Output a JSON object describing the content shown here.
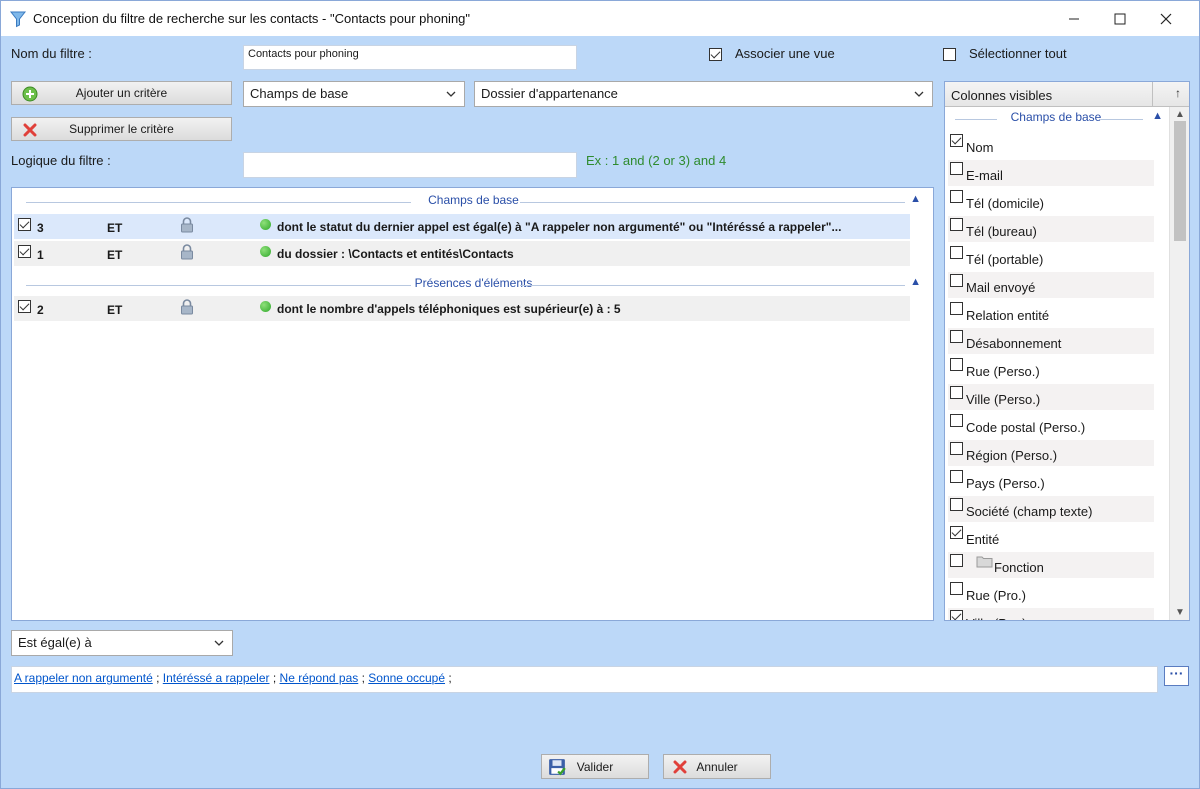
{
  "window": {
    "title": "Conception du filtre de recherche sur les contacts - \"Contacts pour phoning\""
  },
  "form": {
    "filter_name_label": "Nom du filtre :",
    "filter_name_value": "Contacts pour phoning",
    "associate_view_label": "Associer une vue",
    "associate_view_checked": true,
    "select_all_label": "Sélectionner tout",
    "select_all_checked": false,
    "add_criterion_label": "Ajouter un critère",
    "remove_criterion_label": "Supprimer le critère",
    "field_category_select": "Champs de base",
    "field_select": "Dossier d'appartenance",
    "filter_logic_label": "Logique du filtre :",
    "filter_logic_value": "",
    "filter_logic_example": "Ex : 1 and (2 or 3) and 4"
  },
  "criteria": {
    "groups": [
      {
        "name": "Champs de base",
        "rows": [
          {
            "checked": true,
            "num": "3",
            "op": "ET",
            "text": "dont le statut du dernier appel est égal(e) à \"A rappeler non argumenté\" ou \"Intéréssé a rappeler\"...",
            "selected": true
          },
          {
            "checked": true,
            "num": "1",
            "op": "ET",
            "text": "du dossier : \\Contacts et entités\\Contacts",
            "selected": false
          }
        ]
      },
      {
        "name": "Présences d'éléments",
        "rows": [
          {
            "checked": true,
            "num": "2",
            "op": "ET",
            "text": "dont le nombre d'appels téléphoniques est supérieur(e) à : 5",
            "selected": false
          }
        ]
      }
    ]
  },
  "columns": {
    "header": "Colonnes visibles",
    "group": "Champs de base",
    "items": [
      {
        "label": "Nom",
        "checked": true
      },
      {
        "label": "E-mail",
        "checked": false
      },
      {
        "label": "Tél (domicile)",
        "checked": false
      },
      {
        "label": "Tél (bureau)",
        "checked": false
      },
      {
        "label": "Tél (portable)",
        "checked": false
      },
      {
        "label": "Mail envoyé",
        "checked": false
      },
      {
        "label": "Relation entité",
        "checked": false
      },
      {
        "label": "Désabonnement",
        "checked": false
      },
      {
        "label": "Rue (Perso.)",
        "checked": false
      },
      {
        "label": "Ville (Perso.)",
        "checked": false
      },
      {
        "label": "Code postal (Perso.)",
        "checked": false
      },
      {
        "label": "Région (Perso.)",
        "checked": false
      },
      {
        "label": "Pays (Perso.)",
        "checked": false
      },
      {
        "label": "Société (champ texte)",
        "checked": false
      },
      {
        "label": "Entité",
        "checked": true
      },
      {
        "label": "Fonction",
        "checked": false,
        "icon": "folder-icon"
      },
      {
        "label": "Rue (Pro.)",
        "checked": false
      },
      {
        "label": "Ville (Pro.)",
        "checked": true
      }
    ]
  },
  "operator": {
    "value": "Est égal(e) à"
  },
  "values": {
    "items": [
      "A rappeler non argumenté",
      "Intéréssé a rappeler",
      "Ne répond pas",
      "Sonne occupé"
    ],
    "separator": " ; ",
    "trailing": " ;",
    "more_button": "···"
  },
  "buttons": {
    "validate": "Valider",
    "cancel": "Annuler"
  },
  "colors": {
    "background": "#bcd8f8",
    "group_header": "#2a4fa8",
    "link": "#0055cc",
    "example_text": "#2e8b2e",
    "selected_row": "#dbe8fb"
  }
}
